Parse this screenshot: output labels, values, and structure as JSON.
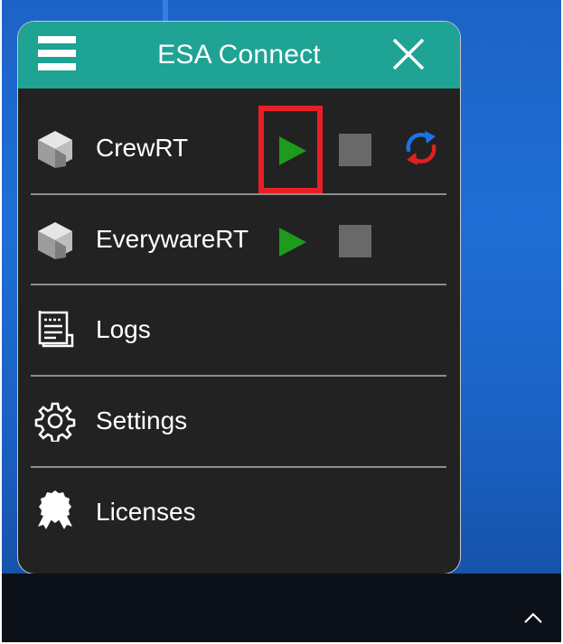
{
  "window": {
    "title": "ESA Connect",
    "header_color": "#1ea394",
    "background_color": "#222222"
  },
  "header": {
    "menu_icon": "hamburger-menu-icon",
    "close_icon": "close-icon"
  },
  "services": [
    {
      "name": "CrewRT",
      "icon": "cube-logo-icon",
      "controls": [
        "play-icon",
        "stop-icon",
        "refresh-icon"
      ],
      "highlighted_control": "play-icon"
    },
    {
      "name": "EverywareRT",
      "icon": "cube-logo-icon",
      "controls": [
        "play-icon",
        "stop-icon"
      ]
    }
  ],
  "menu": [
    {
      "label": "Logs",
      "icon": "logs-document-icon"
    },
    {
      "label": "Settings",
      "icon": "gear-icon"
    },
    {
      "label": "Licenses",
      "icon": "award-ribbon-icon"
    }
  ],
  "colors": {
    "play": "#1c9b1c",
    "stop": "#696969",
    "refresh_blue": "#1a73e8",
    "refresh_red": "#e02020",
    "highlight": "#ea1e25"
  },
  "taskbar": {
    "tray_icon": "chevron-up-icon"
  }
}
